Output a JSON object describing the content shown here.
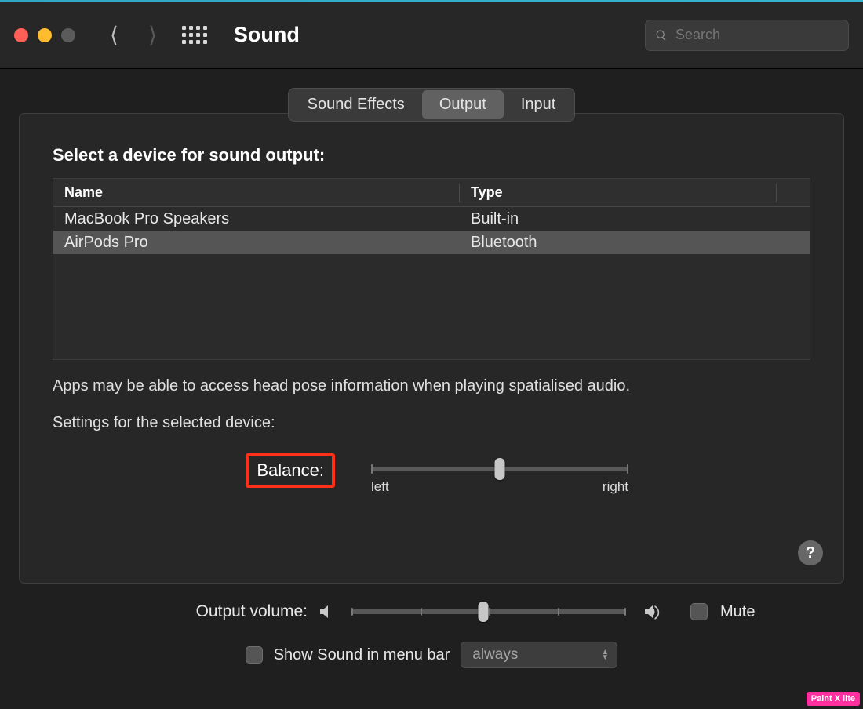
{
  "window": {
    "title": "Sound",
    "search_placeholder": "Search"
  },
  "tabs": {
    "sound_effects": "Sound Effects",
    "output": "Output",
    "input": "Input",
    "selected": "output"
  },
  "output_panel": {
    "select_label": "Select a device for sound output:",
    "columns": {
      "name": "Name",
      "type": "Type"
    },
    "devices": [
      {
        "name": "MacBook Pro Speakers",
        "type": "Built-in"
      },
      {
        "name": "AirPods Pro",
        "type": "Bluetooth"
      }
    ],
    "selected_index": 1,
    "spatial_hint": "Apps may be able to access head pose information when playing spatialised audio.",
    "settings_label": "Settings for the selected device:",
    "balance": {
      "label": "Balance:",
      "left": "left",
      "right": "right",
      "value": 0.5
    },
    "help": "?"
  },
  "footer": {
    "volume_label": "Output volume:",
    "mute": "Mute",
    "show_menu": "Show Sound in menu bar",
    "show_menu_option": "always"
  },
  "watermark": "Paint X lite",
  "annotations": {
    "output_tab_highlighted": true,
    "balance_label_highlighted": true
  }
}
